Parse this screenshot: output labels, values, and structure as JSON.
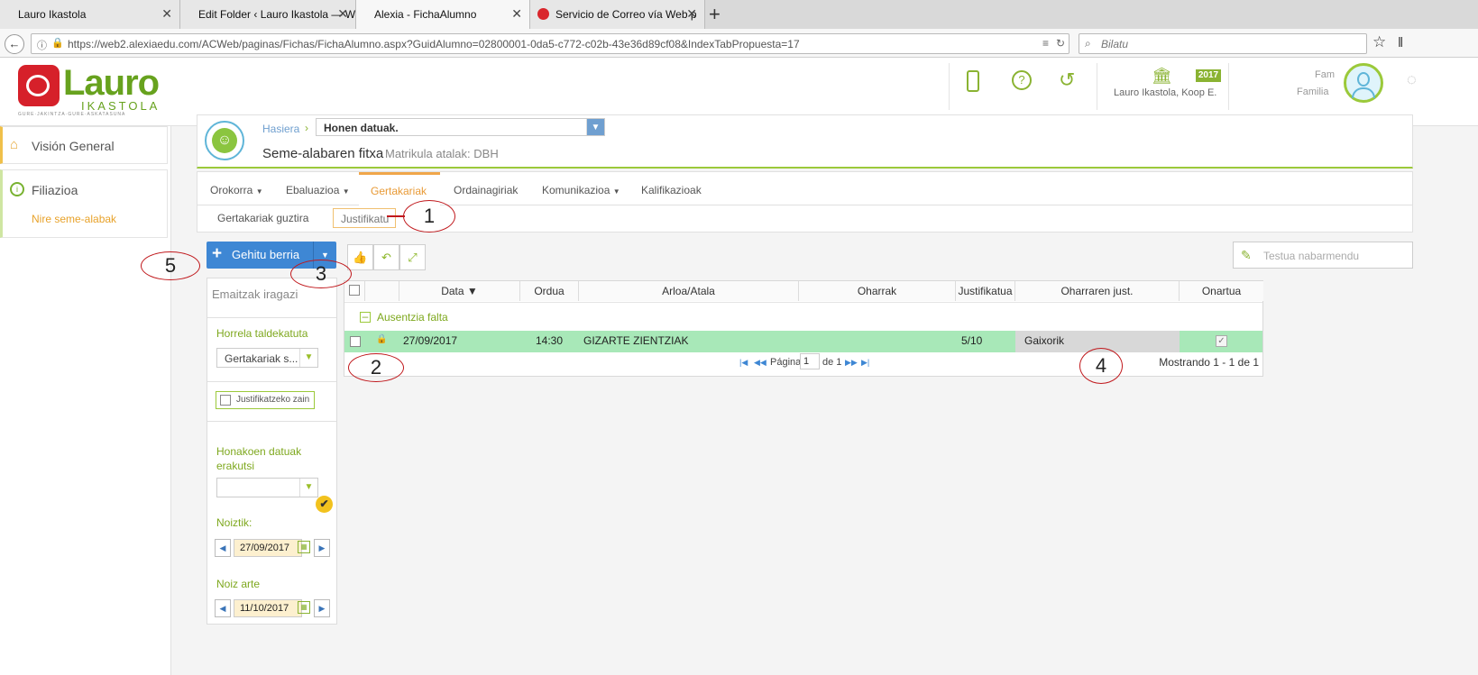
{
  "browser": {
    "tabs": [
      {
        "label": "Lauro Ikastola"
      },
      {
        "label": "Edit Folder ‹ Lauro Ikastola — Wo"
      },
      {
        "label": "Alexia - FichaAlumno"
      },
      {
        "label": "Servicio de Correo vía Web p"
      }
    ],
    "url": "https://web2.alexiaedu.com/ACWeb/paginas/Fichas/FichaAlumno.aspx?GuidAlumno=02800001-0da5-c772-c02b-43e36d89cf08&IndexTabPropuesta=17",
    "search_placeholder": "Bilatu"
  },
  "header": {
    "logo_text": "Lauro",
    "logo_sub": "IKASTOLA",
    "logo_tagline": "GURE·JAKINTZA·GURE·ASKATASUNA",
    "year_badge": "2017",
    "school": "Lauro Ikastola, Koop E.",
    "user_line1": "Fam",
    "user_line2": "Familia"
  },
  "sidebar": {
    "items": [
      {
        "label": "Visión General"
      },
      {
        "label": "Filiazioa"
      }
    ],
    "sub_item": "Nire seme-alabak"
  },
  "breadcrumb": {
    "home": "Hasiera",
    "selector": "Honen datuak."
  },
  "page": {
    "title": "Seme-alabaren fitxa",
    "subtitle": "Matrikula atalak: DBH"
  },
  "tabs": [
    {
      "label": "Orokorra",
      "dropdown": true
    },
    {
      "label": "Ebaluazioa",
      "dropdown": true
    },
    {
      "label": "Gertakariak",
      "dropdown": false
    },
    {
      "label": "Ordainagiriak",
      "dropdown": false
    },
    {
      "label": "Komunikazioa",
      "dropdown": true
    },
    {
      "label": "Kalifikazioak",
      "dropdown": false
    }
  ],
  "subtabs": [
    {
      "label": "Gertakariak guztira"
    },
    {
      "label": "Justifikatu"
    }
  ],
  "toolbar": {
    "add_button": "Gehitu berria",
    "highlight_placeholder": "Testua nabarmendu"
  },
  "filters": {
    "title": "Emaitzak iragazi",
    "group_label": "Horrela taldekatuta",
    "group_value": "Gertakariak s...",
    "pending_label": "Justifikatzeko zain",
    "show_label": "Honakoen datuak erakutsi",
    "show_value": "",
    "from_label": "Noiztik:",
    "from_value": "27/09/2017",
    "to_label": "Noiz arte",
    "to_value": "11/10/2017"
  },
  "grid": {
    "columns": [
      "Data ▼",
      "Ordua",
      "Arloa/Atala",
      "Oharrak",
      "Justifikatua",
      "Oharraren just.",
      "Onartua"
    ],
    "group": "Ausentzia falta",
    "rows": [
      {
        "date": "27/09/2017",
        "time": "14:30",
        "subject": "GIZARTE ZIENTZIAK",
        "notes": "",
        "justified": "5/10",
        "note_just": "Gaixorik",
        "accepted": true
      }
    ],
    "pager": {
      "page_label": "Página",
      "page_value": "1",
      "of_label": "de 1",
      "summary": "Mostrando 1 - 1 de 1"
    }
  },
  "annotations": [
    "1",
    "2",
    "3",
    "4",
    "5"
  ],
  "colors": {
    "accent_green": "#7ea81e",
    "row_green": "#a8e8b8",
    "button_blue": "#3e87d4",
    "tab_orange": "#f0a64a"
  }
}
